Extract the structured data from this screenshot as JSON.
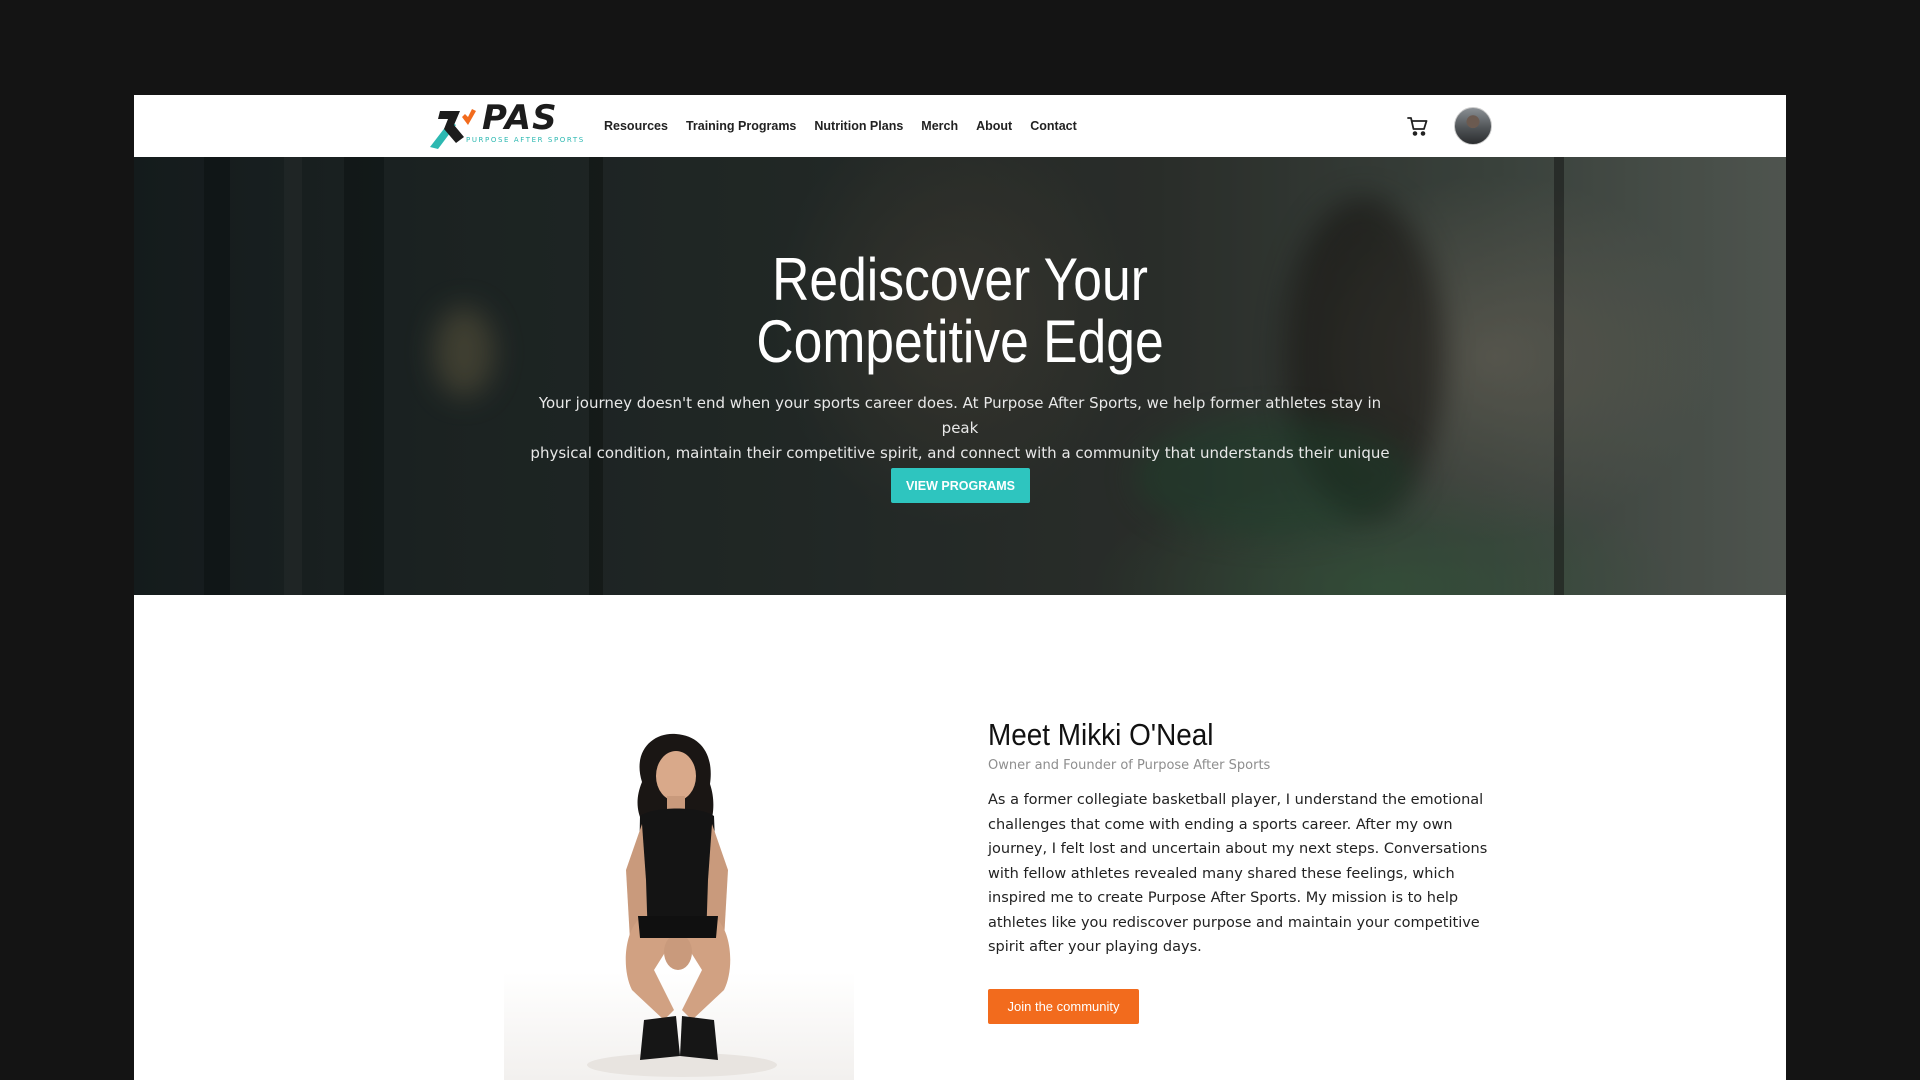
{
  "nav": {
    "logo_word": "PAS",
    "logo_sub": "PURPOSE AFTER SPORTS",
    "items": [
      {
        "label": "Resources"
      },
      {
        "label": "Training Programs"
      },
      {
        "label": "Nutrition Plans"
      },
      {
        "label": "Merch"
      },
      {
        "label": "About"
      },
      {
        "label": "Contact"
      }
    ],
    "cart_icon": "cart-icon",
    "avatar_icon": "user-avatar"
  },
  "hero": {
    "title_line1": "Rediscover Your",
    "title_line2": "Competitive Edge",
    "text_line1": "Your journey doesn't end when your sports career does. At Purpose After Sports, we help former athletes stay in peak",
    "text_line2": "physical condition, maintain their competitive spirit, and connect with a community that understands their unique drive.",
    "button": "VIEW PROGRAMS"
  },
  "about": {
    "title": "Meet Mikki O'Neal",
    "subtitle": "Owner and Founder of Purpose After Sports",
    "paragraph": "As a former collegiate basketball player, I understand the emotional challenges that come with ending a sports career. After my own journey, I felt lost and uncertain about my next steps. Conversations with fellow athletes revealed many shared these feelings, which inspired me to create Purpose After Sports. My mission is to help athletes like you rediscover purpose and maintain your competitive spirit after your playing days.",
    "button": "Join the community"
  },
  "colors": {
    "accent_teal": "#2ec5bf",
    "accent_orange": "#f26b1d",
    "frame": "#141414"
  }
}
